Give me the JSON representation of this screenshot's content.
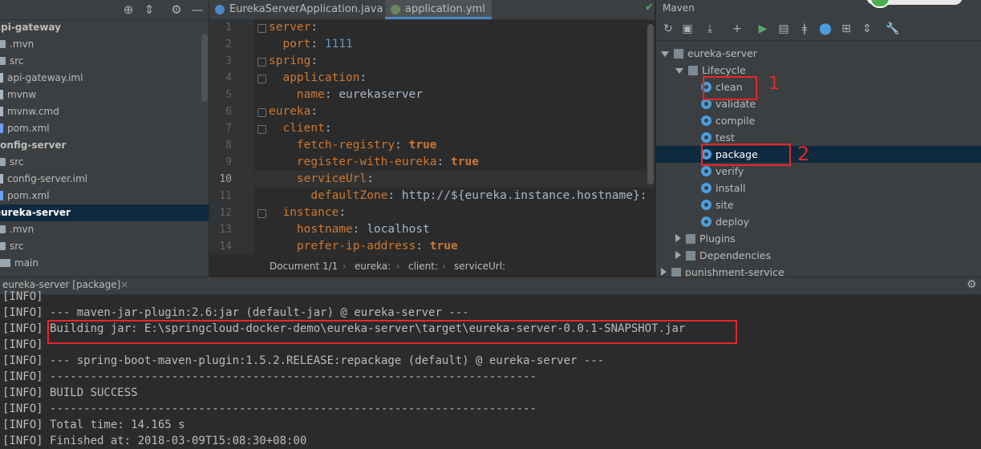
{
  "project": {
    "tree": [
      {
        "label": "api-gateway",
        "kind": "module"
      },
      {
        "label": ".mvn",
        "kind": "folder"
      },
      {
        "label": "src",
        "kind": "folder"
      },
      {
        "label": "api-gateway.iml",
        "kind": "file"
      },
      {
        "label": "mvnw",
        "kind": "file"
      },
      {
        "label": "mvnw.cmd",
        "kind": "file"
      },
      {
        "label": "pom.xml",
        "kind": "maven-file"
      },
      {
        "label": "config-server",
        "kind": "module"
      },
      {
        "label": "src",
        "kind": "folder"
      },
      {
        "label": "config-server.iml",
        "kind": "file"
      },
      {
        "label": "pom.xml",
        "kind": "maven-file"
      },
      {
        "label": "eureka-server",
        "kind": "module-selected"
      },
      {
        "label": ".mvn",
        "kind": "folder"
      },
      {
        "label": "src",
        "kind": "folder"
      },
      {
        "label": "main",
        "kind": "folder"
      }
    ]
  },
  "editor": {
    "tabs": [
      {
        "label": "EurekaServerApplication.java",
        "active": false
      },
      {
        "label": "application.yml",
        "active": true
      }
    ],
    "current_line": "10",
    "lines": [
      {
        "num": "1",
        "key": "server",
        "sep": ":",
        "val": "",
        "indent": 0
      },
      {
        "num": "2",
        "key": "port",
        "sep": ": ",
        "val": "1111",
        "indent": 1
      },
      {
        "num": "3",
        "key": "spring",
        "sep": ":",
        "val": "",
        "indent": 0
      },
      {
        "num": "4",
        "key": "application",
        "sep": ":",
        "val": "",
        "indent": 1
      },
      {
        "num": "5",
        "key": "name",
        "sep": ": ",
        "val": "eurekaserver",
        "indent": 2
      },
      {
        "num": "6",
        "key": "eureka",
        "sep": ":",
        "val": "",
        "indent": 0
      },
      {
        "num": "7",
        "key": "client",
        "sep": ":",
        "val": "",
        "indent": 1
      },
      {
        "num": "8",
        "key": "fetch-registry",
        "sep": ": ",
        "val": "true",
        "indent": 2
      },
      {
        "num": "9",
        "key": "register-with-eureka",
        "sep": ": ",
        "val": "true",
        "indent": 2
      },
      {
        "num": "10",
        "key": "serviceUrl",
        "sep": ":",
        "val": "",
        "indent": 2
      },
      {
        "num": "11",
        "key": "defaultZone",
        "sep": ": ",
        "val": "http://${eureka.instance.hostname}:",
        "indent": 3
      },
      {
        "num": "12",
        "key": "instance",
        "sep": ":",
        "val": "",
        "indent": 1
      },
      {
        "num": "13",
        "key": "hostname",
        "sep": ": ",
        "val": "localhost",
        "indent": 2
      },
      {
        "num": "14",
        "key": "prefer-ip-address",
        "sep": ": ",
        "val": "true",
        "indent": 2
      }
    ],
    "breadcrumb": [
      "Document 1/1",
      "eureka:",
      "client:",
      "serviceUrl:"
    ]
  },
  "maven": {
    "title": "Maven",
    "tree": [
      {
        "label": "eureka-server",
        "level": 0,
        "type": "project"
      },
      {
        "label": "Lifecycle",
        "level": 1,
        "type": "folder-open"
      },
      {
        "label": "clean",
        "level": 2,
        "type": "goal"
      },
      {
        "label": "validate",
        "level": 2,
        "type": "goal"
      },
      {
        "label": "compile",
        "level": 2,
        "type": "goal"
      },
      {
        "label": "test",
        "level": 2,
        "type": "goal"
      },
      {
        "label": "package",
        "level": 2,
        "type": "goal-selected"
      },
      {
        "label": "verify",
        "level": 2,
        "type": "goal"
      },
      {
        "label": "install",
        "level": 2,
        "type": "goal"
      },
      {
        "label": "site",
        "level": 2,
        "type": "goal"
      },
      {
        "label": "deploy",
        "level": 2,
        "type": "goal"
      },
      {
        "label": "Plugins",
        "level": 1,
        "type": "folder-closed"
      },
      {
        "label": "Dependencies",
        "level": 1,
        "type": "folder-closed"
      },
      {
        "label": "punishment-service",
        "level": 0,
        "type": "project-closed"
      }
    ],
    "annotations": {
      "mark1": "1",
      "mark2": "2"
    }
  },
  "run": {
    "tab_label": "eureka-server [package]",
    "lines": [
      "[INFO]",
      "[INFO] --- maven-jar-plugin:2.6:jar (default-jar) @ eureka-server ---",
      "[INFO] Building jar: E:\\springcloud-docker-demo\\eureka-server\\target\\eureka-server-0.0.1-SNAPSHOT.jar",
      "[INFO]",
      "[INFO] --- spring-boot-maven-plugin:1.5.2.RELEASE:repackage (default) @ eureka-server ---",
      "[INFO] ------------------------------------------------------------------------",
      "[INFO] BUILD SUCCESS",
      "[INFO] ------------------------------------------------------------------------",
      "[INFO] Total time: 14.165 s",
      "[INFO] Finished at: 2018-03-09T15:08:30+08:00"
    ]
  },
  "colors": {
    "accent": "#4a88c7",
    "selection": "#0d293e",
    "highlight": "#e8262c"
  }
}
